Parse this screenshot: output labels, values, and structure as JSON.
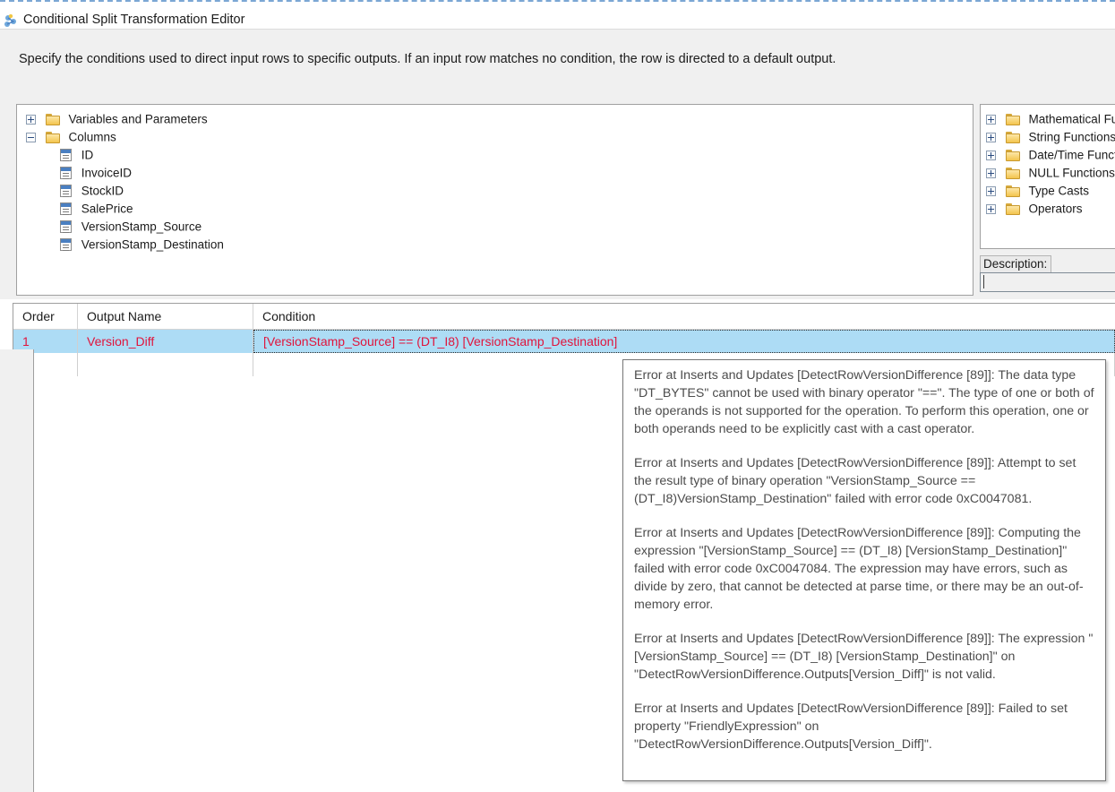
{
  "window": {
    "title": "Conditional Split Transformation Editor",
    "icon": "conditional-split-icon"
  },
  "instruction": {
    "text": "Specify the conditions used to direct input rows to specific outputs. If an input row matches no condition, the row is directed to a default output."
  },
  "tree": {
    "nodes": [
      {
        "label": "Variables and Parameters",
        "icon": "folder-icon",
        "state": "collapsed",
        "indent": 1
      },
      {
        "label": "Columns",
        "icon": "folder-icon",
        "state": "expanded",
        "indent": 1
      },
      {
        "label": "ID",
        "icon": "column-icon",
        "state": "leaf",
        "indent": 2
      },
      {
        "label": "InvoiceID",
        "icon": "column-icon",
        "state": "leaf",
        "indent": 2
      },
      {
        "label": "StockID",
        "icon": "column-icon",
        "state": "leaf",
        "indent": 2
      },
      {
        "label": "SalePrice",
        "icon": "column-icon",
        "state": "leaf",
        "indent": 2
      },
      {
        "label": "VersionStamp_Source",
        "icon": "column-icon",
        "state": "leaf",
        "indent": 2
      },
      {
        "label": "VersionStamp_Destination",
        "icon": "column-icon",
        "state": "leaf",
        "indent": 2
      }
    ]
  },
  "functions": {
    "nodes": [
      {
        "label": "Mathematical Fur",
        "icon": "folder-icon",
        "state": "collapsed"
      },
      {
        "label": "String Functions",
        "icon": "folder-icon",
        "state": "collapsed"
      },
      {
        "label": "Date/Time Functi",
        "icon": "folder-icon",
        "state": "collapsed"
      },
      {
        "label": "NULL Functions",
        "icon": "folder-icon",
        "state": "collapsed"
      },
      {
        "label": "Type Casts",
        "icon": "folder-icon",
        "state": "collapsed"
      },
      {
        "label": "Operators",
        "icon": "folder-icon",
        "state": "collapsed"
      }
    ]
  },
  "description": {
    "label": "Description:",
    "value": "",
    "placeholder": ""
  },
  "grid": {
    "columns": [
      "Order",
      "Output Name",
      "Condition"
    ],
    "rows": [
      {
        "order": "1",
        "output_name": "Version_Diff",
        "condition": "[VersionStamp_Source] == (DT_I8) [VersionStamp_Destination]",
        "selected": true,
        "error": true
      }
    ],
    "selection_color": "#addcf5",
    "error_text_color": "#e0143c"
  },
  "tooltip": {
    "paragraphs": [
      "Error at Inserts and Updates [DetectRowVersionDifference [89]]: The data type \"DT_BYTES\" cannot be used with binary operator \"==\". The type of one or both of the operands is not supported for the operation. To perform this operation, one or both operands need to be explicitly cast with a cast operator.",
      "Error at Inserts and Updates [DetectRowVersionDifference [89]]: Attempt to set the result type of binary operation \"VersionStamp_Source == (DT_I8)VersionStamp_Destination\" failed with error code 0xC0047081.",
      "Error at Inserts and Updates [DetectRowVersionDifference [89]]: Computing the expression \"[VersionStamp_Source] == (DT_I8) [VersionStamp_Destination]\" failed with error code 0xC0047084. The expression may have errors, such as divide by zero, that cannot be detected at parse time, or there may be an out-of-memory error.",
      "Error at Inserts and Updates [DetectRowVersionDifference [89]]: The expression \"[VersionStamp_Source] == (DT_I8) [VersionStamp_Destination]\" on \"DetectRowVersionDifference.Outputs[Version_Diff]\" is not valid.",
      "Error at Inserts and Updates [DetectRowVersionDifference [89]]: Failed to set property \"FriendlyExpression\" on \"DetectRowVersionDifference.Outputs[Version_Diff]\"."
    ]
  }
}
